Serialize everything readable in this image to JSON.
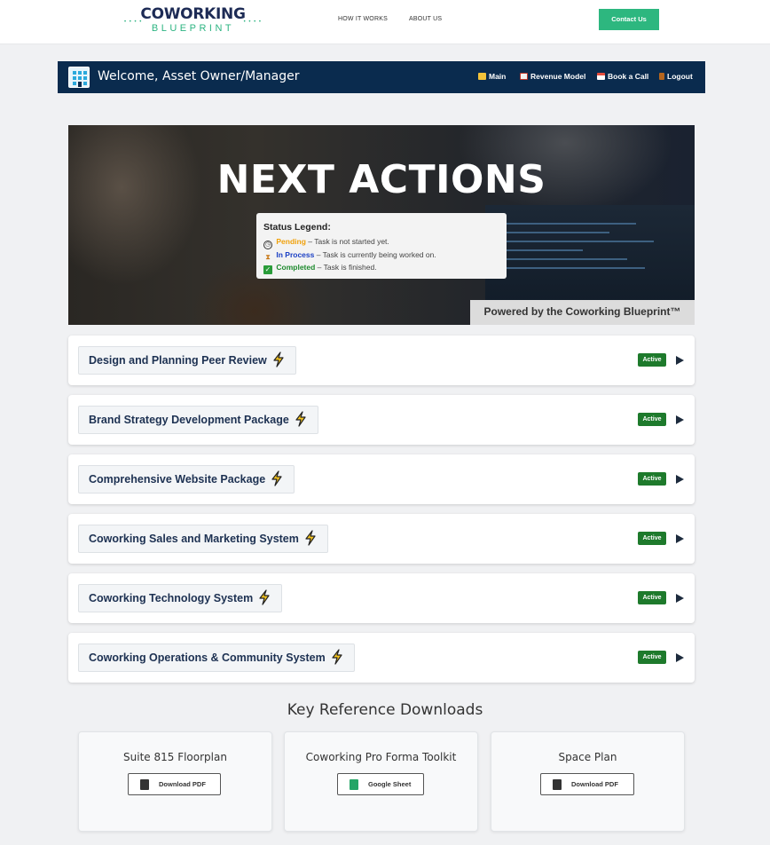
{
  "header": {
    "logo_main": "COWORKING",
    "logo_sub": "BLUEPRINT",
    "nav": [
      "HOW IT WORKS",
      "ABOUT US"
    ],
    "contact_label": "Contact Us",
    "accent_color": "#2db77f"
  },
  "welcome_bar": {
    "title": "Welcome, Asset Owner/Manager",
    "links": [
      {
        "label": "Main",
        "icon": "folder-icon"
      },
      {
        "label": "Revenue Model",
        "icon": "chart-icon"
      },
      {
        "label": "Book a Call",
        "icon": "calendar-icon"
      },
      {
        "label": "Logout",
        "icon": "door-icon"
      }
    ],
    "background": "#0a2b4e"
  },
  "hero": {
    "title": "NEXT ACTIONS",
    "legend_heading": "Status Legend:",
    "legend": [
      {
        "status": "Pending",
        "desc": "– Task is not started yet.",
        "color": "#f0a10c",
        "icon": "clock-icon"
      },
      {
        "status": "In Process",
        "desc": "– Task is currently being worked on.",
        "color": "#1a3fc4",
        "icon": "hourglass-icon"
      },
      {
        "status": "Completed",
        "desc": "– Task is finished.",
        "color": "#1e8a2e",
        "icon": "check-icon"
      }
    ],
    "powered_by": "Powered by the Coworking Blueprint™"
  },
  "actions": [
    {
      "title": "Design and Planning Peer Review",
      "status": "Active"
    },
    {
      "title": "Brand Strategy Development Package",
      "status": "Active"
    },
    {
      "title": "Comprehensive Website Package",
      "status": "Active"
    },
    {
      "title": "Coworking Sales and Marketing System",
      "status": "Active"
    },
    {
      "title": "Coworking Technology System",
      "status": "Active"
    },
    {
      "title": "Coworking Operations & Community System",
      "status": "Active"
    }
  ],
  "downloads": {
    "heading": "Key Reference Downloads",
    "items": [
      {
        "name": "Suite 815 Floorplan",
        "button": "Download PDF",
        "icon": "pdf-icon"
      },
      {
        "name": "Coworking Pro Forma Toolkit",
        "button": "Google Sheet",
        "icon": "sheet-icon"
      },
      {
        "name": "Space Plan",
        "button": "Download PDF",
        "icon": "pdf-icon"
      }
    ]
  }
}
